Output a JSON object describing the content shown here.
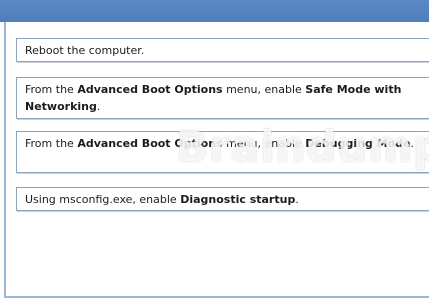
{
  "options": [
    {
      "text": "Reboot the computer.",
      "parts": []
    },
    {
      "parts": [
        "From the ",
        "Advanced Boot Options",
        " menu, enable ",
        "Safe Mode with Networking",
        "."
      ]
    },
    {
      "parts": [
        "From the ",
        "Advanced Boot Options",
        " menu, enable ",
        "Debugging Mode",
        "."
      ]
    },
    {
      "parts": [
        "Using msconfig.exe, enable ",
        "Diagnostic startup",
        "."
      ]
    }
  ],
  "watermark": "Braindump",
  "colors": {
    "title_bar": "#4f7dbd",
    "border": "#8fa3bd"
  }
}
